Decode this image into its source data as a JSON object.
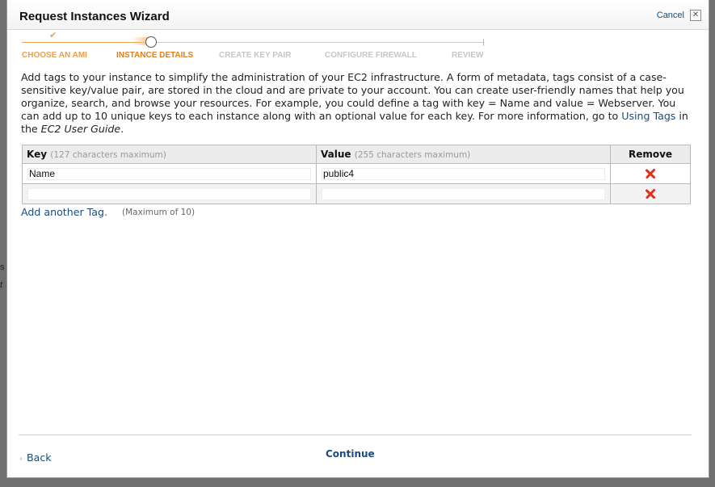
{
  "background": {
    "fragment_1": "s",
    "fragment_2": "t"
  },
  "dialog": {
    "title": "Request Instances Wizard",
    "cancel_label": "Cancel",
    "close_label": "✕"
  },
  "wizard": {
    "steps": [
      {
        "label": "CHOOSE AN AMI",
        "state": "done",
        "color": "#e8a04c"
      },
      {
        "label": "INSTANCE DETAILS",
        "state": "current",
        "color": "#e07e1a"
      },
      {
        "label": "CREATE KEY PAIR",
        "state": "pending",
        "color": "#c6c6c6"
      },
      {
        "label": "CONFIGURE FIREWALL",
        "state": "pending",
        "color": "#c6c6c6"
      },
      {
        "label": "REVIEW",
        "state": "pending",
        "color": "#c6c6c6"
      }
    ]
  },
  "description": {
    "part1": "Add tags to your instance to simplify the administration of your EC2 infrastructure. A form of metadata, tags consist of a case-sensitive key/value pair, are stored in the cloud and are private to your account. You can create user-friendly names that help you organize, search, and browse your resources. For example, you could define a tag with key = Name and value = Webserver. You can add up to 10 unique keys to each instance along with an optional value for each key. For more information, go to ",
    "link": "Using Tags",
    "part2": " in the ",
    "guide": "EC2 User Guide",
    "part3": "."
  },
  "tags_table": {
    "headers": {
      "key": "Key",
      "key_hint": "(127 characters maximum)",
      "value": "Value",
      "value_hint": "(255 characters maximum)",
      "remove": "Remove"
    },
    "rows": [
      {
        "key": "Name",
        "value": "public4"
      },
      {
        "key": "",
        "value": ""
      }
    ]
  },
  "add_tag": {
    "label": "Add another Tag.",
    "limit": "(Maximum of 10)"
  },
  "footer": {
    "back_label": "Back",
    "continue_label": "Continue"
  },
  "colors": {
    "link": "#1a4b7e",
    "accent": "#e8a04c",
    "remove_icon": "#e0301e"
  }
}
